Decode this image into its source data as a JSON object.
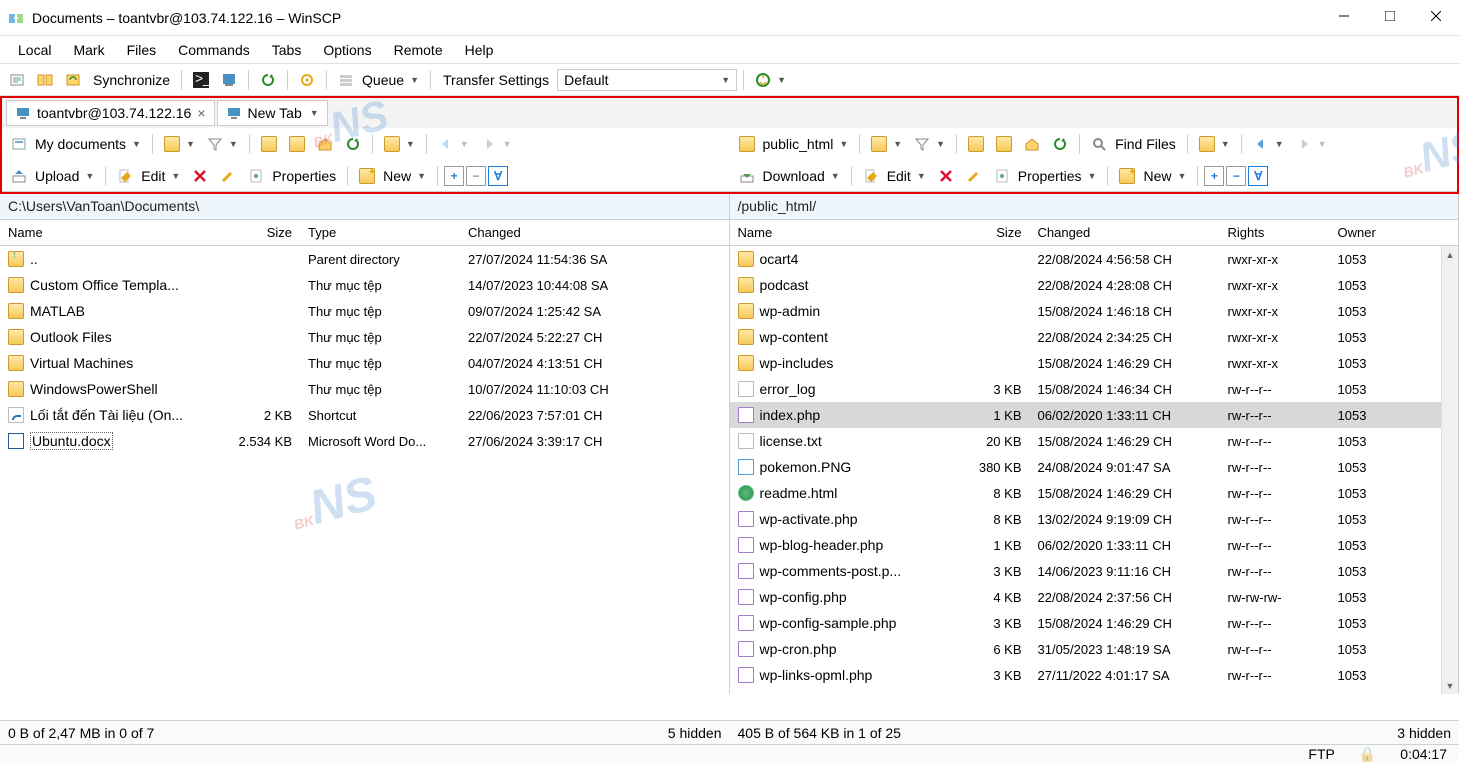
{
  "title": "Documents – toantvbr@103.74.122.16 – WinSCP",
  "menubar": [
    "Local",
    "Mark",
    "Files",
    "Commands",
    "Tabs",
    "Options",
    "Remote",
    "Help"
  ],
  "toolbar1": {
    "sync": "Synchronize",
    "queue": "Queue",
    "transfer_label": "Transfer Settings",
    "transfer_value": "Default"
  },
  "tabs": [
    {
      "label": "toantvbr@103.74.122.16",
      "closable": true,
      "active": true
    },
    {
      "label": "New Tab",
      "closable": false,
      "active": false
    }
  ],
  "left": {
    "dir_combo": "My documents",
    "actions": {
      "upload": "Upload",
      "edit": "Edit",
      "props": "Properties",
      "new": "New"
    },
    "path": "C:\\Users\\VanToan\\Documents\\",
    "cols": {
      "name": "Name",
      "size": "Size",
      "type": "Type",
      "changed": "Changed"
    },
    "rows": [
      {
        "icon": "up",
        "name": "..",
        "size": "",
        "type": "Parent directory",
        "changed": "27/07/2024 11:54:36 SA"
      },
      {
        "icon": "folder",
        "name": "Custom Office Templa...",
        "size": "",
        "type": "Thư mục tệp",
        "changed": "14/07/2023 10:44:08 SA"
      },
      {
        "icon": "folder",
        "name": "MATLAB",
        "size": "",
        "type": "Thư mục tệp",
        "changed": "09/07/2024 1:25:42 SA"
      },
      {
        "icon": "folder",
        "name": "Outlook Files",
        "size": "",
        "type": "Thư mục tệp",
        "changed": "22/07/2024 5:22:27 CH"
      },
      {
        "icon": "folder",
        "name": "Virtual Machines",
        "size": "",
        "type": "Thư mục tệp",
        "changed": "04/07/2024 4:13:51 CH"
      },
      {
        "icon": "folder",
        "name": "WindowsPowerShell",
        "size": "",
        "type": "Thư mục tệp",
        "changed": "10/07/2024 11:10:03 CH"
      },
      {
        "icon": "link",
        "name": "Lối tắt đến Tài liệu (On...",
        "size": "2 KB",
        "type": "Shortcut",
        "changed": "22/06/2023 7:57:01 CH"
      },
      {
        "icon": "word",
        "name": "Ubuntu.docx",
        "size": "2.534 KB",
        "type": "Microsoft Word Do...",
        "changed": "27/06/2024 3:39:17 CH",
        "focus": true
      }
    ],
    "status_left": "0 B of 2,47 MB in 0 of 7",
    "status_right": "5 hidden"
  },
  "right": {
    "dir_combo": "public_html",
    "find": "Find Files",
    "actions": {
      "download": "Download",
      "edit": "Edit",
      "props": "Properties",
      "new": "New"
    },
    "path": "/public_html/",
    "cols": {
      "name": "Name",
      "size": "Size",
      "changed": "Changed",
      "rights": "Rights",
      "owner": "Owner"
    },
    "rows": [
      {
        "icon": "folder",
        "name": "ocart4",
        "size": "",
        "changed": "22/08/2024 4:56:58 CH",
        "rights": "rwxr-xr-x",
        "owner": "1053"
      },
      {
        "icon": "folder",
        "name": "podcast",
        "size": "",
        "changed": "22/08/2024 4:28:08 CH",
        "rights": "rwxr-xr-x",
        "owner": "1053"
      },
      {
        "icon": "folder",
        "name": "wp-admin",
        "size": "",
        "changed": "15/08/2024 1:46:18 CH",
        "rights": "rwxr-xr-x",
        "owner": "1053"
      },
      {
        "icon": "folder",
        "name": "wp-content",
        "size": "",
        "changed": "22/08/2024 2:34:25 CH",
        "rights": "rwxr-xr-x",
        "owner": "1053"
      },
      {
        "icon": "folder",
        "name": "wp-includes",
        "size": "",
        "changed": "15/08/2024 1:46:29 CH",
        "rights": "rwxr-xr-x",
        "owner": "1053"
      },
      {
        "icon": "file",
        "name": "error_log",
        "size": "3 KB",
        "changed": "15/08/2024 1:46:34 CH",
        "rights": "rw-r--r--",
        "owner": "1053"
      },
      {
        "icon": "php",
        "name": "index.php",
        "size": "1 KB",
        "changed": "06/02/2020 1:33:11 CH",
        "rights": "rw-r--r--",
        "owner": "1053",
        "selected": true
      },
      {
        "icon": "file",
        "name": "license.txt",
        "size": "20 KB",
        "changed": "15/08/2024 1:46:29 CH",
        "rights": "rw-r--r--",
        "owner": "1053"
      },
      {
        "icon": "png",
        "name": "pokemon.PNG",
        "size": "380 KB",
        "changed": "24/08/2024 9:01:47 SA",
        "rights": "rw-r--r--",
        "owner": "1053"
      },
      {
        "icon": "html",
        "name": "readme.html",
        "size": "8 KB",
        "changed": "15/08/2024 1:46:29 CH",
        "rights": "rw-r--r--",
        "owner": "1053"
      },
      {
        "icon": "php",
        "name": "wp-activate.php",
        "size": "8 KB",
        "changed": "13/02/2024 9:19:09 CH",
        "rights": "rw-r--r--",
        "owner": "1053"
      },
      {
        "icon": "php",
        "name": "wp-blog-header.php",
        "size": "1 KB",
        "changed": "06/02/2020 1:33:11 CH",
        "rights": "rw-r--r--",
        "owner": "1053"
      },
      {
        "icon": "php",
        "name": "wp-comments-post.p...",
        "size": "3 KB",
        "changed": "14/06/2023 9:11:16 CH",
        "rights": "rw-r--r--",
        "owner": "1053"
      },
      {
        "icon": "php",
        "name": "wp-config.php",
        "size": "4 KB",
        "changed": "22/08/2024 2:37:56 CH",
        "rights": "rw-rw-rw-",
        "owner": "1053"
      },
      {
        "icon": "php",
        "name": "wp-config-sample.php",
        "size": "3 KB",
        "changed": "15/08/2024 1:46:29 CH",
        "rights": "rw-r--r--",
        "owner": "1053"
      },
      {
        "icon": "php",
        "name": "wp-cron.php",
        "size": "6 KB",
        "changed": "31/05/2023 1:48:19 SA",
        "rights": "rw-r--r--",
        "owner": "1053"
      },
      {
        "icon": "php",
        "name": "wp-links-opml.php",
        "size": "3 KB",
        "changed": "27/11/2022 4:01:17 SA",
        "rights": "rw-r--r--",
        "owner": "1053"
      }
    ],
    "status_left": "405 B of 564 KB in 1 of 25",
    "status_right": "3 hidden"
  },
  "bottom": {
    "proto": "FTP",
    "time": "0:04:17"
  }
}
